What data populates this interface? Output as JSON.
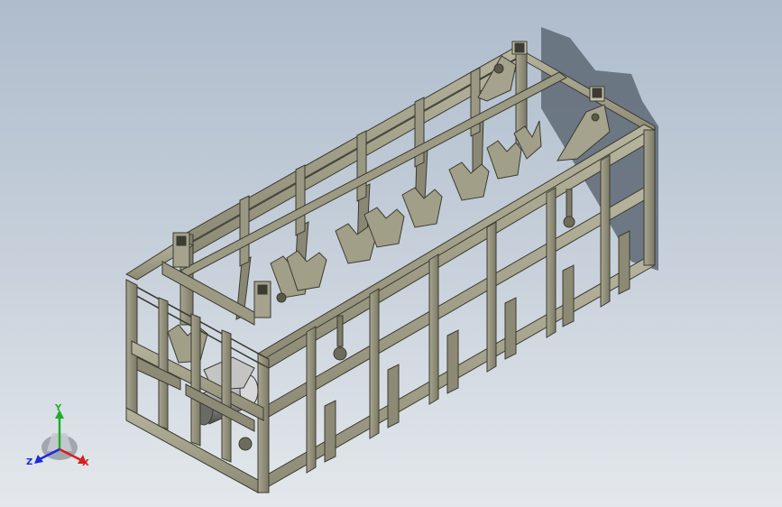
{
  "viewport": {
    "model": "steel-frame-rack"
  },
  "triad": {
    "x_label": "X",
    "y_label": "Y",
    "z_label": "Z",
    "colors": {
      "x": "#d42020",
      "y": "#1fae2a",
      "z": "#1b2ad8"
    }
  },
  "colors": {
    "background_top": "#aebccc",
    "background_bottom": "#e4e8ec",
    "frame_face": "#9c9a83",
    "frame_edge": "#3b3a31",
    "shadow": "#5e6875"
  }
}
